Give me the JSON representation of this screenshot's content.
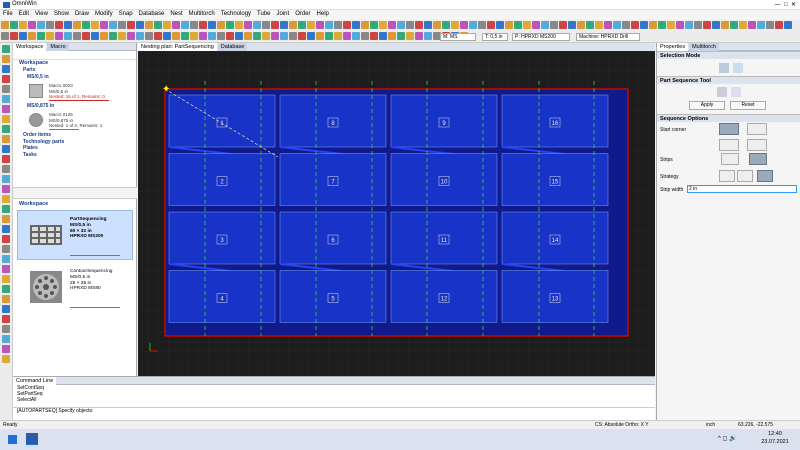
{
  "app": {
    "title": "OmniWin"
  },
  "menu": [
    "File",
    "Edit",
    "View",
    "Show",
    "Draw",
    "Modify",
    "Snap",
    "Database",
    "Nest",
    "Multitorch",
    "Technology",
    "Tube",
    "Joint",
    "Order",
    "Help"
  ],
  "toolbar2": {
    "material": "M: MS",
    "thickness": "T: 0,5 in",
    "process": "P: HPRXD MS200",
    "machine": "Machine: HPRXD Drill"
  },
  "left_panel": {
    "tabs": [
      "Workspace",
      "Macro"
    ],
    "tree": {
      "root": "Workspace",
      "parts": "Parts",
      "group1": "MS/0,5 in",
      "macro1": {
        "lines": [
          "Macro 0023",
          "MS/0,5 in"
        ],
        "status": "Nested: 16 of 1, Remains: 0"
      },
      "group2": "MS/0,875 in",
      "macro2": {
        "lines": [
          "Macro 0125",
          "MS/0,875 in",
          "Nested: 1 of 2, Remains: 1"
        ]
      },
      "links": [
        "Order items",
        "Technology parts",
        "Plates",
        "Tasks"
      ]
    },
    "workspace_title": "Workspace",
    "items": [
      {
        "lines": [
          "PartSequencing",
          "MS/0,5 in",
          "60 × 32 in",
          "HPRXD MS200"
        ]
      },
      {
        "lines": [
          "ContourSequencing",
          "MS/0,5 in",
          "25 × 35 in",
          "HPRXD MS80"
        ]
      }
    ]
  },
  "canvas_tabs": [
    "Nesting plan: PartSequencing",
    "Database"
  ],
  "parts": [
    "1",
    "8",
    "9",
    "16",
    "2",
    "7",
    "10",
    "15",
    "3",
    "6",
    "11",
    "14",
    "4",
    "5",
    "12",
    "13"
  ],
  "right_panel": {
    "tabs": [
      "Properties",
      "Multitorch"
    ],
    "selection_mode": "Selection Mode",
    "part_sequence_tool": "Part Sequence Tool",
    "apply": "Apply",
    "reset": "Reset",
    "sequence_options": "Sequence Options",
    "start_corner": "Start corner",
    "strips": "Strips",
    "strategy": "Strategy",
    "strip_width": "Strip width",
    "strip_width_value": "2 in"
  },
  "command_line": {
    "title": "Command Line",
    "lines": [
      "SetContSeq",
      "SetPartSeq",
      "SelectAll"
    ],
    "prompt": "[AUTOPARTSEQ] Specify objects:"
  },
  "status": {
    "left": "Ready",
    "cs": "CS: Absolute Ortho: X Y",
    "unit": "inch",
    "coords": "63.226, -22.575"
  },
  "taskbar": {
    "time": "12:40",
    "date": "23.07.2021"
  }
}
